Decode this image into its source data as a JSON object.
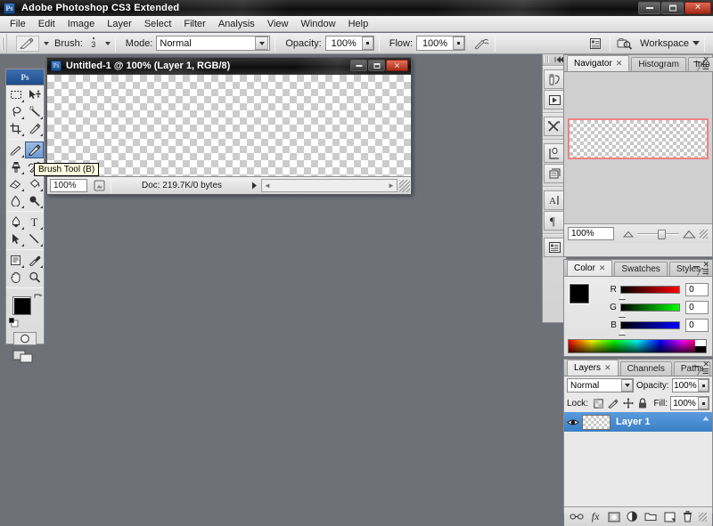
{
  "window": {
    "app_title": "Adobe Photoshop CS3 Extended",
    "app_badge": "Ps",
    "minimize_label": "Minimize",
    "maximize_label": "Maximize",
    "close_label": "Close"
  },
  "menubar": {
    "items": [
      {
        "label": "File"
      },
      {
        "label": "Edit"
      },
      {
        "label": "Image"
      },
      {
        "label": "Layer"
      },
      {
        "label": "Select"
      },
      {
        "label": "Filter"
      },
      {
        "label": "Analysis"
      },
      {
        "label": "View"
      },
      {
        "label": "Window"
      },
      {
        "label": "Help"
      }
    ]
  },
  "options_bar": {
    "tool_icon": "brush-icon",
    "brush_label": "Brush:",
    "brush_size": "3",
    "mode_label": "Mode:",
    "mode_value": "Normal",
    "opacity_label": "Opacity:",
    "opacity_value": "100%",
    "flow_label": "Flow:",
    "flow_value": "100%",
    "airbrush_icon": "airbrush-icon",
    "palettes_icon": "palettes-toggle-icon",
    "bridge_icon": "go-to-bridge-icon",
    "workspace_label": "Workspace"
  },
  "toolbox": {
    "badge": "Ps",
    "tools": [
      {
        "name": "marquee-tool",
        "icon": "marquee-icon"
      },
      {
        "name": "move-tool",
        "icon": "move-icon"
      },
      {
        "name": "lasso-tool",
        "icon": "lasso-icon"
      },
      {
        "name": "magic-wand-tool",
        "icon": "magic-wand-icon"
      },
      {
        "name": "crop-tool",
        "icon": "crop-icon"
      },
      {
        "name": "slice-tool",
        "icon": "slice-icon"
      },
      {
        "name": "healing-brush-tool",
        "icon": "healing-brush-icon"
      },
      {
        "name": "brush-tool",
        "icon": "brush-icon"
      },
      {
        "name": "clone-stamp-tool",
        "icon": "clone-stamp-icon"
      },
      {
        "name": "history-brush-tool",
        "icon": "history-brush-icon"
      },
      {
        "name": "eraser-tool",
        "icon": "eraser-icon"
      },
      {
        "name": "gradient-tool",
        "icon": "paint-bucket-icon"
      },
      {
        "name": "blur-tool",
        "icon": "blur-drop-icon"
      },
      {
        "name": "dodge-tool",
        "icon": "dodge-icon"
      },
      {
        "name": "pen-tool",
        "icon": "pen-icon"
      },
      {
        "name": "type-tool",
        "icon": "type-icon"
      },
      {
        "name": "path-selection-tool",
        "icon": "path-arrow-icon"
      },
      {
        "name": "line-tool",
        "icon": "line-shape-icon"
      },
      {
        "name": "notes-tool",
        "icon": "notes-icon"
      },
      {
        "name": "eyedropper-tool",
        "icon": "eyedropper-icon"
      },
      {
        "name": "hand-tool",
        "icon": "hand-icon"
      },
      {
        "name": "zoom-tool",
        "icon": "magnifier-icon"
      }
    ],
    "selected_tool": "brush-tool",
    "foreground_color": "#000000",
    "background_color": "#ffffff",
    "quick_mask_icon": "quick-mask-icon",
    "screen_mode_icon": "screen-mode-icon",
    "tooltip": "Brush Tool (B)"
  },
  "document": {
    "icon": "document-icon",
    "title": "Untitled-1 @ 100% (Layer 1, RGB/8)",
    "zoom": "100%",
    "info": "Doc: 219.7K/0 bytes",
    "minimize_label": "Minimize",
    "maximize_label": "Maximize",
    "close_label": "Close"
  },
  "dock_strip": {
    "buttons": [
      {
        "name": "brushes-panel-button",
        "icon": "brushes-icon"
      },
      {
        "name": "animation-panel-button",
        "icon": "animation-play-icon"
      },
      {
        "name": "tool-presets-panel-button",
        "icon": "tool-presets-icon"
      },
      {
        "name": "clone-source-panel-button",
        "icon": "clone-source-icon"
      },
      {
        "name": "layer-comps-panel-button",
        "icon": "layer-comps-icon"
      },
      {
        "name": "character-panel-button",
        "icon": "character-icon"
      },
      {
        "name": "paragraph-panel-button",
        "icon": "paragraph-icon"
      },
      {
        "name": "histogram-panel-button",
        "icon": "histogram-panel-icon"
      }
    ],
    "collapse_icon": "collapse-dock-icon"
  },
  "navigator_panel": {
    "tabs": [
      {
        "label": "Navigator",
        "active": true,
        "closable": true
      },
      {
        "label": "Histogram",
        "active": false,
        "closable": false
      },
      {
        "label": "Info",
        "active": false,
        "closable": false
      }
    ],
    "zoom_value": "100%",
    "zoom_out_icon": "zoom-out-icon",
    "zoom_in_icon": "zoom-in-icon",
    "menu_icon": "panel-menu-icon",
    "view_box_color": "#f08080"
  },
  "color_panel": {
    "tabs": [
      {
        "label": "Color",
        "active": true,
        "closable": true
      },
      {
        "label": "Swatches",
        "active": false,
        "closable": false
      },
      {
        "label": "Styles",
        "active": false,
        "closable": false
      }
    ],
    "foreground_color": "#000000",
    "background_color": "#ffffff",
    "channels": [
      {
        "label": "R",
        "value": "0"
      },
      {
        "label": "G",
        "value": "0"
      },
      {
        "label": "B",
        "value": "0"
      }
    ],
    "menu_icon": "panel-menu-icon"
  },
  "layers_panel": {
    "tabs": [
      {
        "label": "Layers",
        "active": true,
        "closable": true
      },
      {
        "label": "Channels",
        "active": false,
        "closable": false
      },
      {
        "label": "Paths",
        "active": false,
        "closable": false
      }
    ],
    "blend_mode": "Normal",
    "opacity_label": "Opacity:",
    "opacity_value": "100%",
    "lock_label": "Lock:",
    "lock_buttons": [
      {
        "name": "lock-transparent-pixels",
        "icon": "lock-transparency-icon"
      },
      {
        "name": "lock-image-pixels",
        "icon": "lock-paint-icon"
      },
      {
        "name": "lock-position",
        "icon": "lock-move-icon"
      },
      {
        "name": "lock-all",
        "icon": "lock-all-icon"
      }
    ],
    "fill_label": "Fill:",
    "fill_value": "100%",
    "layers": [
      {
        "name": "Layer 1",
        "visible": true,
        "selected": true
      }
    ],
    "footer_buttons": [
      {
        "name": "link-layers-button",
        "icon": "link-icon"
      },
      {
        "name": "layer-style-button",
        "icon": "fx-icon"
      },
      {
        "name": "layer-mask-button",
        "icon": "mask-icon"
      },
      {
        "name": "adjustment-layer-button",
        "icon": "adjustment-circle-icon"
      },
      {
        "name": "new-group-button",
        "icon": "folder-icon"
      },
      {
        "name": "new-layer-button",
        "icon": "new-layer-icon"
      },
      {
        "name": "delete-layer-button",
        "icon": "trash-icon"
      }
    ],
    "menu_icon": "panel-menu-icon",
    "selected_row_color": "#3a7fc4"
  }
}
